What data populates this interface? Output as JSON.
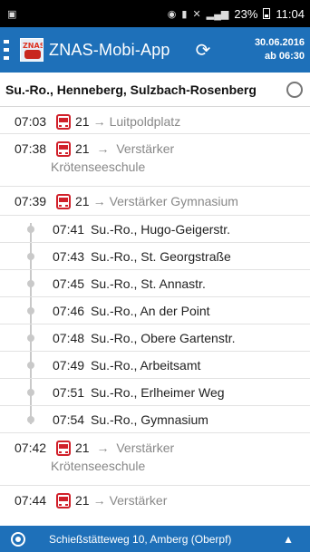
{
  "status_bar": {
    "battery": "23%",
    "time": "11:04"
  },
  "app_bar": {
    "logo_text": "ZNAS",
    "title": "ZNAS-Mobi-App",
    "date": "30.06.2016",
    "from_time": "ab 06:30"
  },
  "stop": {
    "title": "Su.-Ro., Henneberg, Sulzbach-Rosenberg"
  },
  "departures": [
    {
      "time": "07:03",
      "line": "21",
      "arrow": "→",
      "dest": "Luitpoldplatz",
      "dest2": ""
    },
    {
      "time": "07:38",
      "line": "21",
      "arrow": "→",
      "dest": "Verstärker",
      "dest2": "Krötenseeschule"
    },
    {
      "time": "07:39",
      "line": "21",
      "arrow": "→",
      "dest": "Verstärker Gymnasium",
      "dest2": ""
    },
    {
      "time": "07:42",
      "line": "21",
      "arrow": "→",
      "dest": "Verstärker",
      "dest2": "Krötenseeschule"
    },
    {
      "time": "07:44",
      "line": "21",
      "arrow": "→",
      "dest": "Verstärker",
      "dest2": ""
    }
  ],
  "expanded_stops": [
    {
      "time": "07:41",
      "name": "Su.-Ro., Hugo-Geigerstr."
    },
    {
      "time": "07:43",
      "name": "Su.-Ro., St. Georgstraße"
    },
    {
      "time": "07:45",
      "name": "Su.-Ro., St. Annastr."
    },
    {
      "time": "07:46",
      "name": "Su.-Ro., An der Point"
    },
    {
      "time": "07:48",
      "name": "Su.-Ro., Obere Gartenstr."
    },
    {
      "time": "07:49",
      "name": "Su.-Ro., Arbeitsamt"
    },
    {
      "time": "07:51",
      "name": "Su.-Ro., Erlheimer Weg"
    },
    {
      "time": "07:54",
      "name": "Su.-Ro., Gymnasium"
    }
  ],
  "bottom_bar": {
    "address": "Schießstätteweg 10, Amberg (Oberpf)",
    "expand_icon": "chevron-up-icon"
  },
  "colors": {
    "primary": "#1e70b9",
    "bus_icon": "#d1202a"
  }
}
